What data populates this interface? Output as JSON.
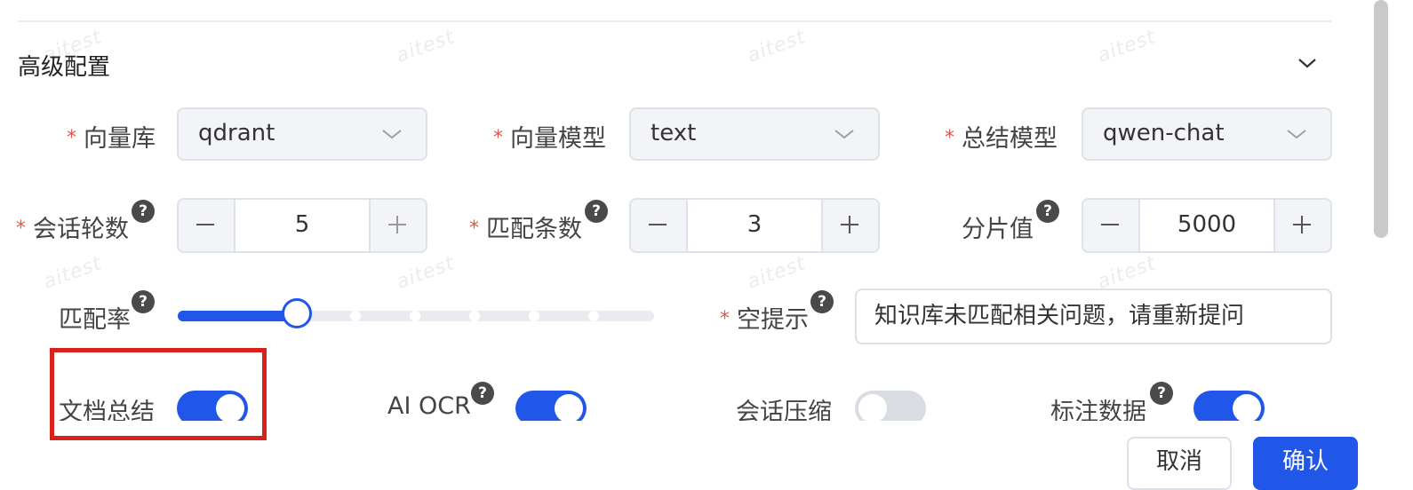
{
  "watermark": "aitest",
  "section": {
    "title": "高级配置"
  },
  "fields": {
    "vector_store": {
      "label": "向量库",
      "value": "qdrant"
    },
    "vector_model": {
      "label": "向量模型",
      "value": "text"
    },
    "summary_model": {
      "label": "总结模型",
      "value": "qwen-chat"
    },
    "conversation_rounds": {
      "label": "会话轮数",
      "value": "5"
    },
    "match_count": {
      "label": "匹配条数",
      "value": "3"
    },
    "chunk_size": {
      "label": "分片值",
      "value": "5000"
    },
    "match_rate": {
      "label": "匹配率",
      "value_fraction": 0.25
    },
    "empty_hint": {
      "label": "空提示",
      "value": "知识库未匹配相关问题，请重新提问"
    }
  },
  "toggles": {
    "doc_summary": {
      "label": "文档总结",
      "on": true
    },
    "ai_ocr": {
      "label": "AI OCR",
      "on": true
    },
    "conversation_compress": {
      "label": "会话压缩",
      "on": false
    },
    "annotation_data": {
      "label": "标注数据",
      "on": true
    }
  },
  "footer": {
    "cancel_label": "取消",
    "confirm_label": "确认"
  },
  "icons": {
    "help": "?",
    "required": "*"
  },
  "colors": {
    "accent": "#2057e8",
    "required": "#e2574c",
    "highlight": "#d8201c",
    "toggle_off": "#d9dce3"
  }
}
